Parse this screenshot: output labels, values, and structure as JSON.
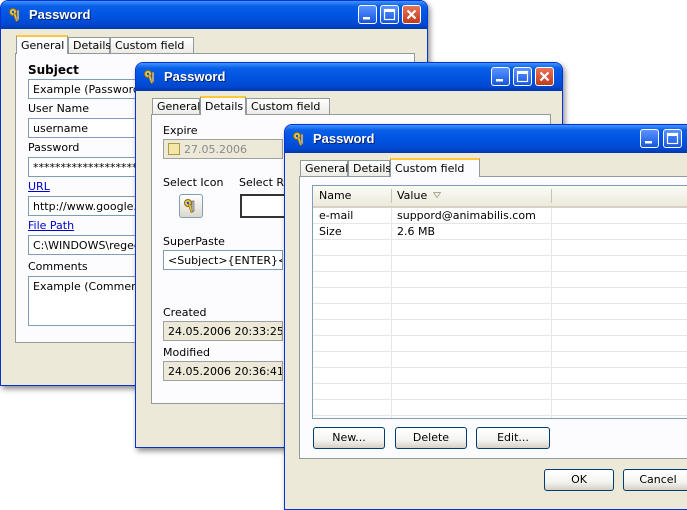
{
  "window1": {
    "title": "Password",
    "tabs": [
      "General",
      "Details",
      "Custom field"
    ],
    "subject_label": "Subject",
    "subject_value": "Example (Password)",
    "username_label": "User Name",
    "username_value": "username",
    "password_label": "Password",
    "password_value": "*******************",
    "url_label": "URL",
    "url_value": "http://www.google.c",
    "filepath_label": "File Path",
    "filepath_value": "C:\\WINDOWS\\regedi",
    "comments_label": "Comments",
    "comments_value": "Example (Comments)"
  },
  "window2": {
    "title": "Password",
    "tabs": [
      "General",
      "Details",
      "Custom field"
    ],
    "expire_label": "Expire",
    "expire_value": "27.05.2006",
    "select_icon_label": "Select Icon",
    "select_row_label": "Select Ro",
    "superpaste_label": "SuperPaste",
    "superpaste_value": "<Subject>{ENTER}<Us",
    "created_label": "Created",
    "created_value": "24.05.2006 20:33:25",
    "modified_label": "Modified",
    "modified_value": "24.05.2006 20:36:41"
  },
  "window3": {
    "title": "Password",
    "tabs": [
      "General",
      "Details",
      "Custom field"
    ],
    "columns": [
      "Name",
      "Value"
    ],
    "rows": [
      {
        "name": "e-mail",
        "value": "suppord@animabilis.com"
      },
      {
        "name": "Size",
        "value": "2.6 MB"
      }
    ],
    "new_button": "New...",
    "delete_button": "Delete",
    "edit_button": "Edit...",
    "ok_button": "OK",
    "cancel_button": "Cancel"
  },
  "icons": {
    "title_icon": "keys-icon",
    "minimize": "minimize-icon",
    "maximize": "maximize-icon",
    "close": "close-icon",
    "sort": "sort-arrow-icon",
    "calendar": "calendar-checkbox-icon"
  },
  "colors": {
    "titlebar": "#0054e3",
    "window_bg": "#ece9d8",
    "active_tab_accent": "#ffc83c",
    "link": "#0000cc"
  }
}
